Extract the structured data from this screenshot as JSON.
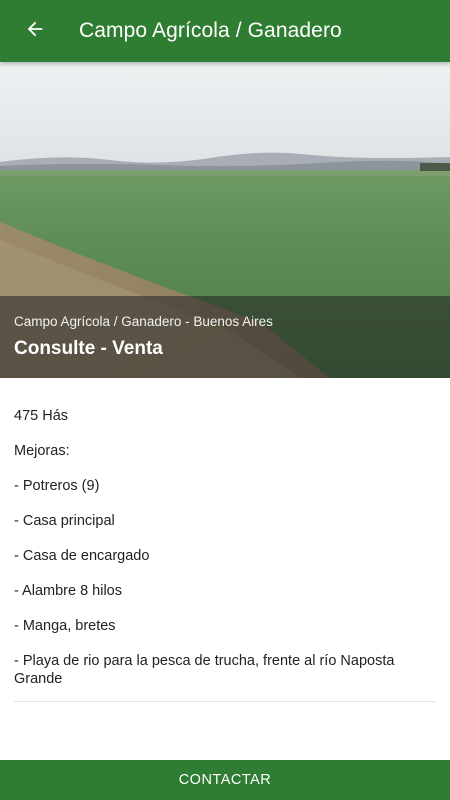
{
  "appbar": {
    "title": "Campo Agrícola / Ganadero",
    "back_icon": "arrow-left-icon"
  },
  "hero": {
    "subtitle": "Campo Agrícola / Ganadero - Buenos Aires",
    "title": "Consulte - Venta"
  },
  "details": {
    "lines": [
      "475 Hás",
      "Mejoras:",
      "- Potreros (9)",
      "- Casa principal",
      "- Casa de encargado",
      "- Alambre 8 hilos",
      "- Manga, bretes",
      "- Playa de rio para la pesca de trucha, frente al río Naposta Grande"
    ]
  },
  "footer": {
    "contact_label": "CONTACTAR"
  },
  "colors": {
    "primary": "#2f7d32",
    "text": "#222222"
  }
}
